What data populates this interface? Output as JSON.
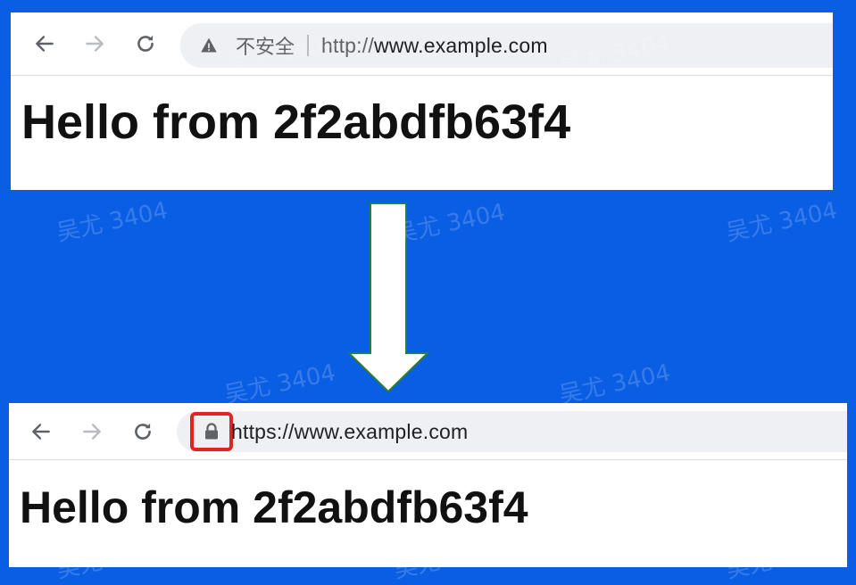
{
  "top_browser": {
    "security_label": "不安全",
    "url_scheme": "http://",
    "url_host": "www.example.com",
    "heading": "Hello from 2f2abdfb63f4"
  },
  "bottom_browser": {
    "url_scheme": "https://",
    "url_host": "www.example.com",
    "heading": "Hello from 2f2abdfb63f4"
  },
  "watermark": "吴尤 3404",
  "colors": {
    "background": "#0a5ee4",
    "highlight": "#e02424",
    "omnibox": "#eef0f3"
  },
  "icons": [
    "back-arrow-icon",
    "forward-arrow-icon",
    "reload-icon",
    "warning-icon",
    "lock-icon",
    "down-arrow-icon"
  ]
}
